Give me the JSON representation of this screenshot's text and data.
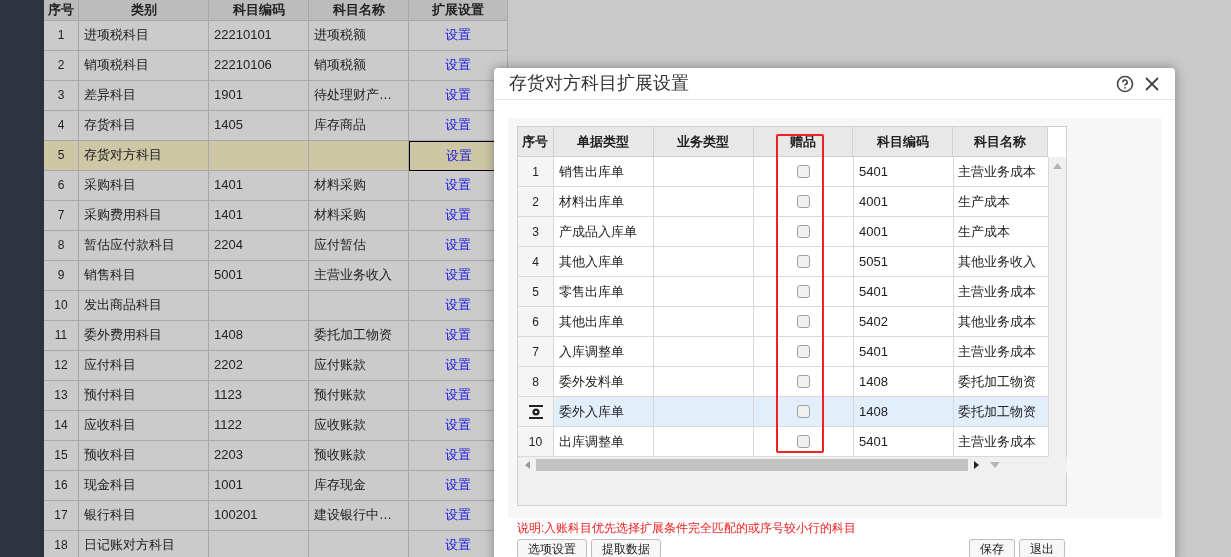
{
  "background_table": {
    "columns": [
      "序号",
      "类别",
      "科目编码",
      "科目名称",
      "扩展设置"
    ],
    "rows": [
      {
        "no": "1",
        "category": "进项税科目",
        "code": "22210101",
        "name": "进项税额",
        "action": "设置",
        "selected": false
      },
      {
        "no": "2",
        "category": "销项税科目",
        "code": "22210106",
        "name": "销项税额",
        "action": "设置",
        "selected": false
      },
      {
        "no": "3",
        "category": "差异科目",
        "code": "1901",
        "name": "待处理财产…",
        "action": "设置",
        "selected": false
      },
      {
        "no": "4",
        "category": "存货科目",
        "code": "1405",
        "name": "库存商品",
        "action": "设置",
        "selected": false
      },
      {
        "no": "5",
        "category": "存货对方科目",
        "action": "设置",
        "selected": true
      },
      {
        "no": "6",
        "category": "采购科目",
        "code": "1401",
        "name": "材料采购",
        "action": "设置",
        "selected": false
      },
      {
        "no": "7",
        "category": "采购费用科目",
        "code": "1401",
        "name": "材料采购",
        "action": "设置",
        "selected": false
      },
      {
        "no": "8",
        "category": "暂估应付款科目",
        "code": "2204",
        "name": "应付暂估",
        "action": "设置",
        "selected": false
      },
      {
        "no": "9",
        "category": "销售科目",
        "code": "5001",
        "name": "主营业务收入",
        "action": "设置",
        "selected": false
      },
      {
        "no": "10",
        "category": "发出商品科目",
        "action": "设置",
        "selected": false
      },
      {
        "no": "11",
        "category": "委外费用科目",
        "code": "1408",
        "name": "委托加工物资",
        "action": "设置",
        "selected": false
      },
      {
        "no": "12",
        "category": "应付科目",
        "code": "2202",
        "name": "应付账款",
        "action": "设置",
        "selected": false
      },
      {
        "no": "13",
        "category": "预付科目",
        "code": "1123",
        "name": "预付账款",
        "action": "设置",
        "selected": false
      },
      {
        "no": "14",
        "category": "应收科目",
        "code": "1122",
        "name": "应收账款",
        "action": "设置",
        "selected": false
      },
      {
        "no": "15",
        "category": "预收科目",
        "code": "2203",
        "name": "预收账款",
        "action": "设置",
        "selected": false
      },
      {
        "no": "16",
        "category": "现金科目",
        "code": "1001",
        "name": "库存现金",
        "action": "设置",
        "selected": false
      },
      {
        "no": "17",
        "category": "银行科目",
        "code": "100201",
        "name": "建设银行中…",
        "action": "设置",
        "selected": false
      },
      {
        "no": "18",
        "category": "日记账对方科目",
        "action": "设置",
        "selected": false
      }
    ]
  },
  "dialog": {
    "title": "存货对方科目扩展设置",
    "columns": [
      "序号",
      "单据类型",
      "业务类型",
      "赠品",
      "科目编码",
      "科目名称"
    ],
    "rows": [
      {
        "no": "1",
        "doc_type": "销售出库单",
        "gift": false,
        "code": "5401",
        "name": "主营业务成本",
        "selected": false
      },
      {
        "no": "2",
        "doc_type": "材料出库单",
        "gift": false,
        "code": "4001",
        "name": "生产成本",
        "selected": false
      },
      {
        "no": "3",
        "doc_type": "产成品入库单",
        "gift": false,
        "code": "4001",
        "name": "生产成本",
        "selected": false
      },
      {
        "no": "4",
        "doc_type": "其他入库单",
        "gift": false,
        "code": "5051",
        "name": "其他业务收入",
        "selected": false
      },
      {
        "no": "5",
        "doc_type": "零售出库单",
        "gift": false,
        "code": "5401",
        "name": "主营业务成本",
        "selected": false
      },
      {
        "no": "6",
        "doc_type": "其他出库单",
        "gift": false,
        "code": "5402",
        "name": "其他业务成本",
        "selected": false
      },
      {
        "no": "7",
        "doc_type": "入库调整单",
        "gift": false,
        "code": "5401",
        "name": "主营业务成本",
        "selected": false
      },
      {
        "no": "8",
        "doc_type": "委外发料单",
        "gift": false,
        "code": "1408",
        "name": "委托加工物资",
        "selected": false
      },
      {
        "doc_type": "委外入库单",
        "gift": false,
        "code": "1408",
        "name": "委托加工物资",
        "selected": true
      },
      {
        "no": "10",
        "doc_type": "出库调整单",
        "gift": false,
        "code": "5401",
        "name": "主营业务成本",
        "selected": false
      }
    ],
    "note": "说明:入账科目优先选择扩展条件完全匹配的或序号较小行的科目",
    "left_buttons": [
      "选项设置",
      "提取数据"
    ],
    "right_buttons": [
      "保存",
      "退出"
    ]
  }
}
